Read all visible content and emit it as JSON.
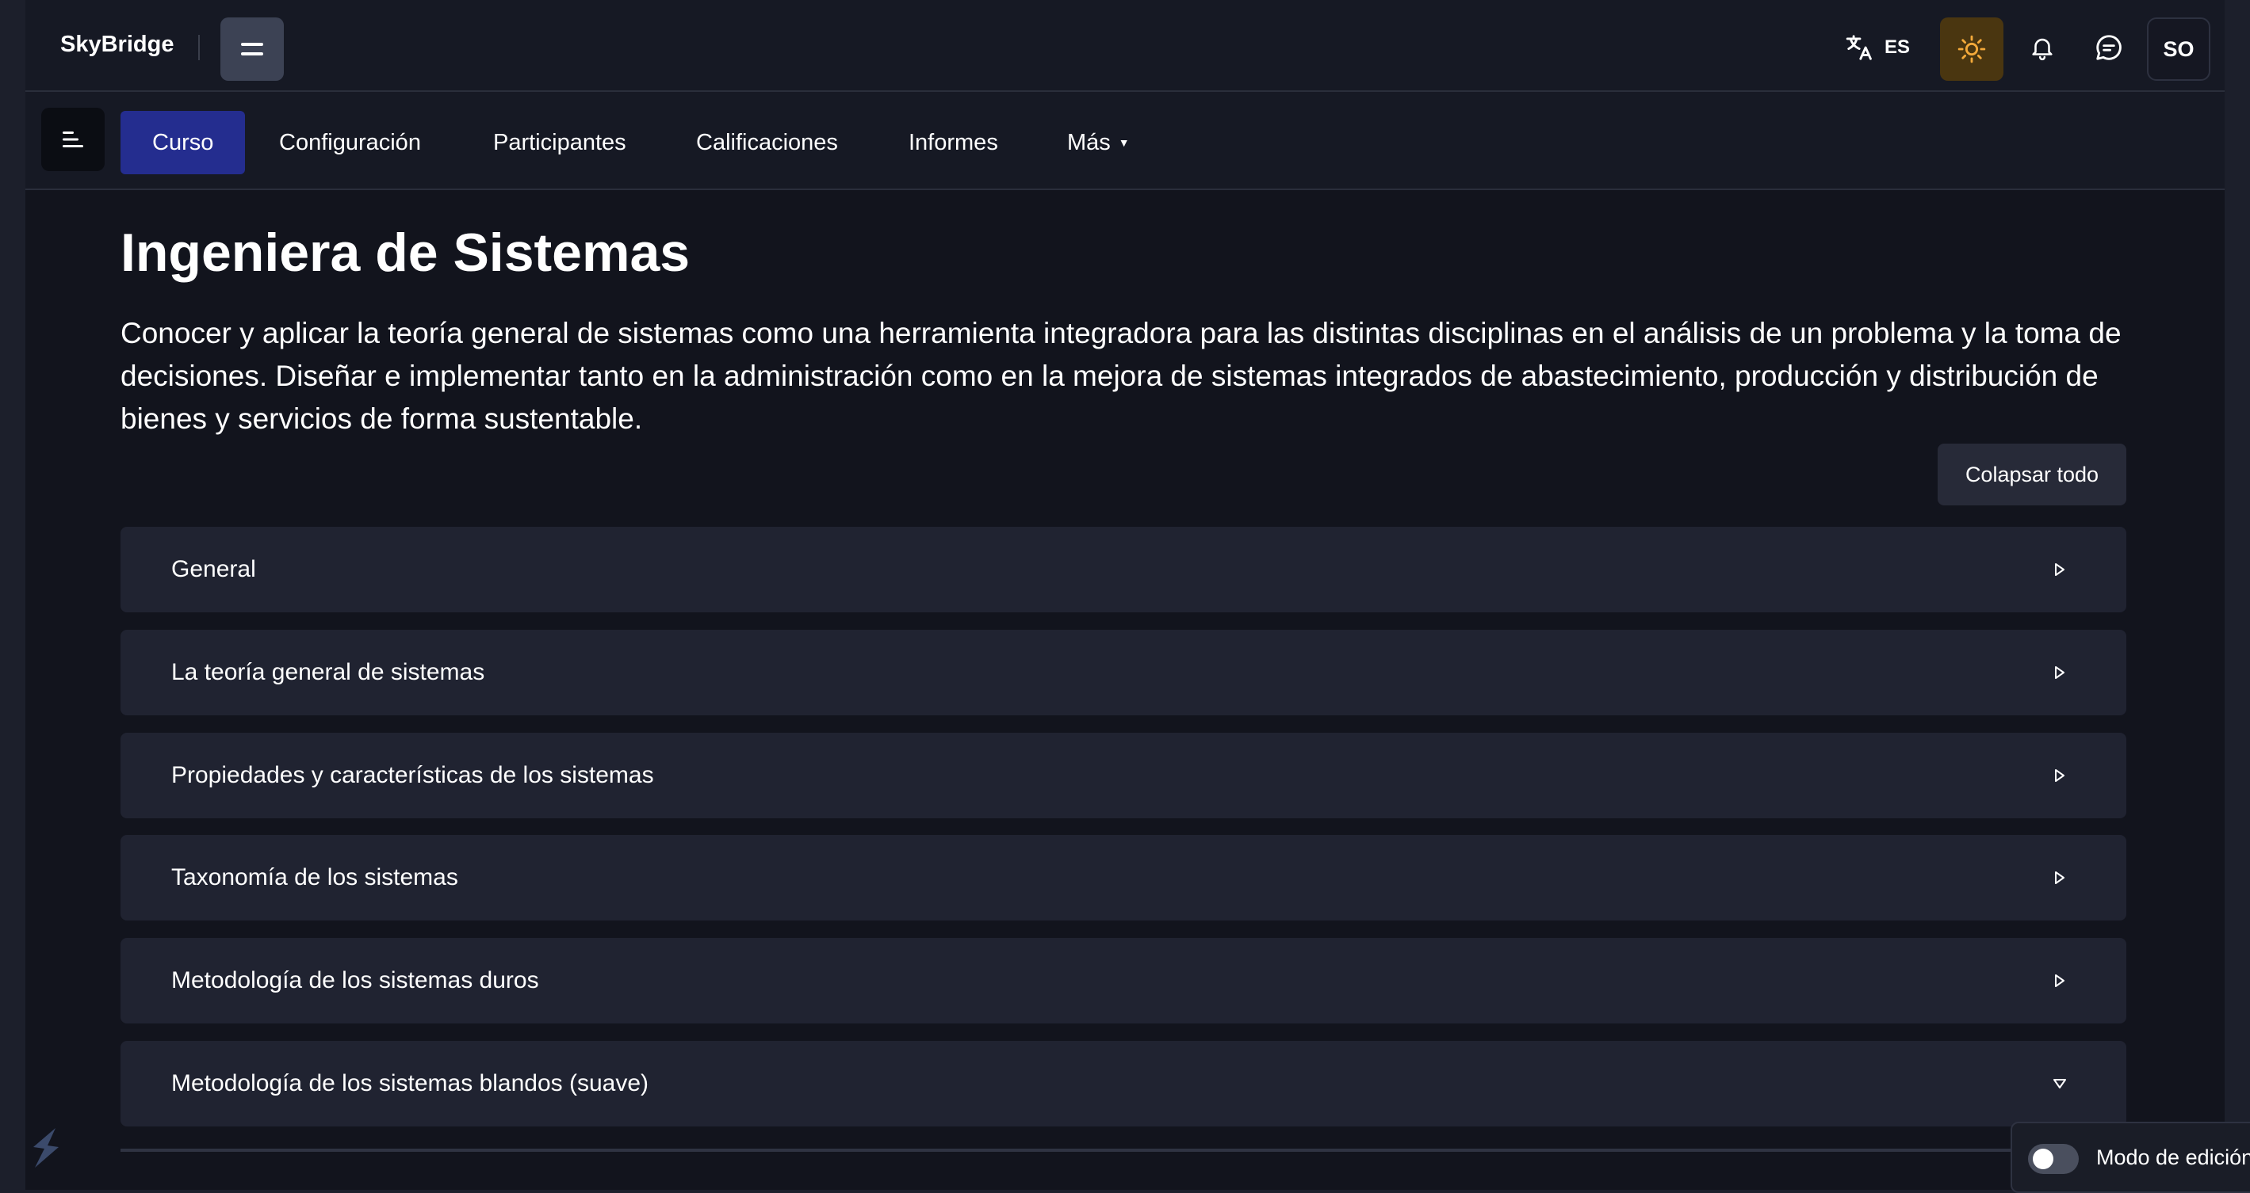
{
  "app": {
    "brand": "SkyBridge"
  },
  "header": {
    "language_code": "ES",
    "avatar_initials": "SO",
    "colors": {
      "background": "#161924",
      "theme_button": "#4a3610",
      "sun_icon": "#f3a93a"
    },
    "icons": [
      "drawer-icon",
      "translate-icon",
      "sun-icon",
      "bell-icon",
      "chat-icon"
    ]
  },
  "nav": {
    "tabs": [
      {
        "label": "Curso",
        "active": true
      },
      {
        "label": "Configuración",
        "active": false
      },
      {
        "label": "Participantes",
        "active": false
      },
      {
        "label": "Calificaciones",
        "active": false
      },
      {
        "label": "Informes",
        "active": false
      },
      {
        "label": "Más",
        "active": false
      }
    ],
    "active_color": "#242d8f"
  },
  "course": {
    "title": "Ingeniera de Sistemas",
    "summary": "Conocer y aplicar la teoría general de sistemas como una herramienta integradora para las distintas disciplinas en el análisis de un problema y la toma de decisiones. Diseñar e implementar tanto en la administración como en la mejora de sistemas integrados de abastecimiento, producción y distribución de bienes y servicios de forma sustentable.",
    "collapse_all_label": "Colapsar todo",
    "sections": [
      {
        "label": "General",
        "expanded": false
      },
      {
        "label": "La teoría general de sistemas",
        "expanded": false
      },
      {
        "label": "Propiedades y características de los sistemas",
        "expanded": false
      },
      {
        "label": "Taxonomía de los sistemas",
        "expanded": false
      },
      {
        "label": "Metodología de los sistemas duros",
        "expanded": false
      },
      {
        "label": "Metodología de los sistemas blandos (suave)",
        "expanded": true
      }
    ]
  },
  "footer": {
    "edit_mode_label": "Modo de edición",
    "edit_mode_on": false
  }
}
